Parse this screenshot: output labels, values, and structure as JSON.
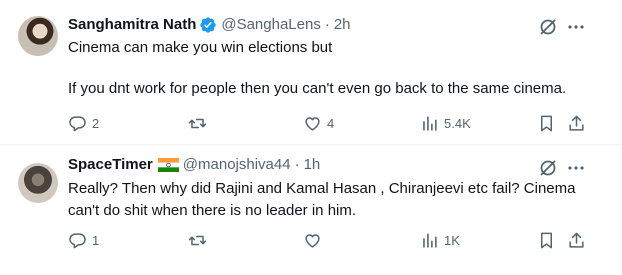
{
  "tweets": [
    {
      "author": "Sanghamitra Nath",
      "handle": "@SanghaLens",
      "separator": "·",
      "time": "2h",
      "verified": true,
      "lines": [
        "Cinema can make you win elections but",
        "If you dnt work for people then you can't even go back to the same cinema."
      ],
      "stats": {
        "replies": "2",
        "retweets": "",
        "likes": "4",
        "views": "5.4K"
      }
    },
    {
      "author": "SpaceTimer",
      "handle": "@manojshiva44",
      "separator": "·",
      "time": "1h",
      "flag": "india-flag",
      "lines": [
        "Really? Then why did Rajini and Kamal Hasan , Chiranjeevi etc fail? Cinema",
        "can't do shit when there is no leader in him."
      ],
      "stats": {
        "replies": "1",
        "retweets": "",
        "likes": "",
        "views": "1K"
      }
    }
  ],
  "colors": {
    "text": "#0f1419",
    "muted": "#536471",
    "verified": "#1d9bf0",
    "divider": "#eff3f4"
  },
  "icons": [
    "verified-badge-icon",
    "grok-icon",
    "more-icon",
    "reply-icon",
    "retweet-icon",
    "like-icon",
    "views-icon",
    "bookmark-icon",
    "share-icon"
  ]
}
